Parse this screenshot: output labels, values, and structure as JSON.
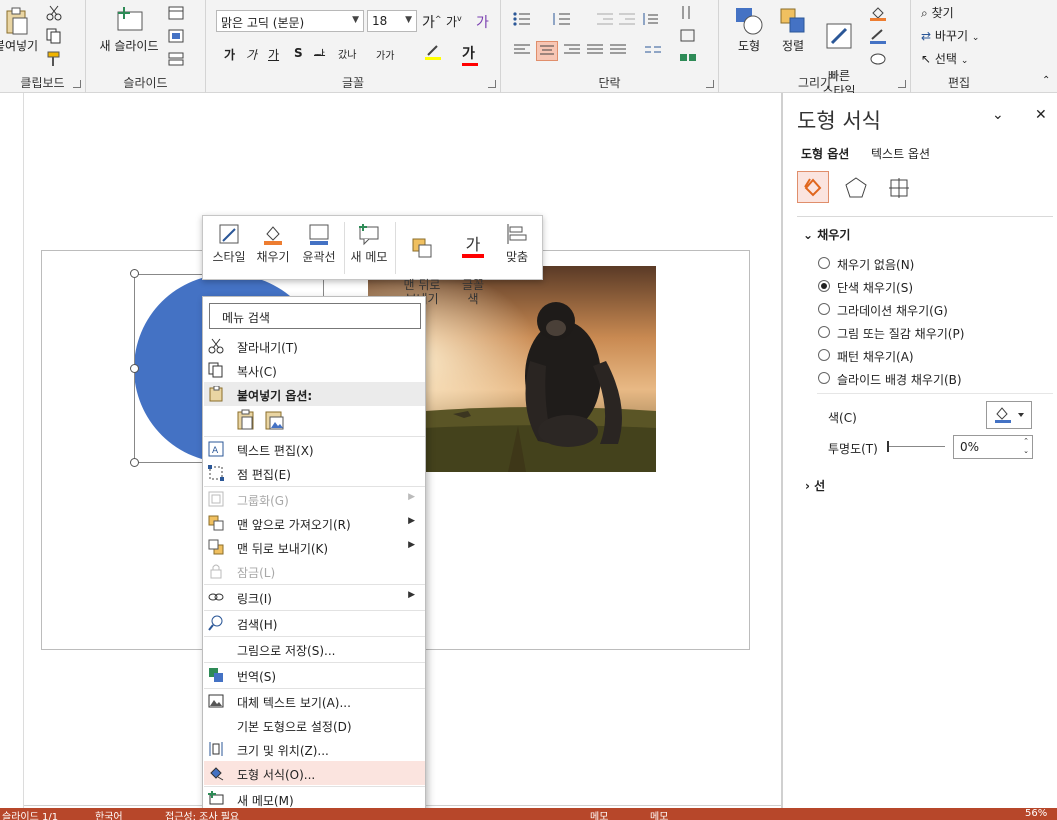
{
  "ribbon": {
    "clipboard": {
      "paste_label": "붙여넣기",
      "group_label": "클립보드"
    },
    "slides": {
      "new_slide_label": "새 슬라이드",
      "group_label": "슬라이드"
    },
    "font": {
      "font_name": "맑은 고딕 (본문)",
      "font_size": "18",
      "grow_label": "가",
      "shrink_label": "가",
      "clear_label": "가",
      "bold": "가",
      "italic": "가",
      "underline": "가",
      "shadow": "S",
      "strike": "ᆉ",
      "spacing": "갔나",
      "case": "가가",
      "highlight_color": "#ffff00",
      "font_color": "#ff0000",
      "font_color_label": "가",
      "group_label": "글꼴"
    },
    "paragraph": {
      "group_label": "단락"
    },
    "drawing": {
      "shapes_label": "도형",
      "arrange_label": "정렬",
      "quick_styles_label": "빠른\n스타일",
      "group_label": "그리기"
    },
    "editing": {
      "find_label": "찾기",
      "replace_label": "바꾸기",
      "select_label": "선택",
      "group_label": "편집"
    }
  },
  "mini_toolbar": {
    "items": [
      {
        "label": "스타일"
      },
      {
        "label": "채우기"
      },
      {
        "label": "윤곽선"
      },
      {
        "label": "새 메모"
      },
      {
        "label": "맨 뒤로\n보내기"
      },
      {
        "label": "글꼴\n색"
      },
      {
        "label": "맞춤"
      }
    ]
  },
  "context_menu": {
    "search_placeholder": "메뉴 검색",
    "items": [
      {
        "label": "잘라내기(T)",
        "icon": "scissors-icon",
        "disabled": false,
        "submenu": false
      },
      {
        "label": "복사(C)",
        "icon": "copy-icon",
        "disabled": false,
        "submenu": false
      },
      {
        "label": "붙여넣기 옵션:",
        "icon": "paste-icon",
        "disabled": false,
        "submenu": false,
        "header": true
      },
      {
        "label": "텍스트 편집(X)",
        "icon": "edit-text-icon",
        "disabled": false,
        "submenu": false
      },
      {
        "label": "점 편집(E)",
        "icon": "edit-points-icon",
        "disabled": false,
        "submenu": false
      },
      {
        "label": "그룹화(G)",
        "icon": "group-icon",
        "disabled": true,
        "submenu": true
      },
      {
        "label": "맨 앞으로 가져오기(R)",
        "icon": "bring-front-icon",
        "disabled": false,
        "submenu": true
      },
      {
        "label": "맨 뒤로 보내기(K)",
        "icon": "send-back-icon",
        "disabled": false,
        "submenu": true
      },
      {
        "label": "잠금(L)",
        "icon": "lock-icon",
        "disabled": true,
        "submenu": false
      },
      {
        "label": "링크(I)",
        "icon": "link-icon",
        "disabled": false,
        "submenu": true
      },
      {
        "label": "검색(H)",
        "icon": "search-icon",
        "disabled": false,
        "submenu": false
      },
      {
        "label": "그림으로 저장(S)...",
        "icon": "",
        "disabled": false,
        "submenu": false
      },
      {
        "label": "번역(S)",
        "icon": "translate-icon",
        "disabled": false,
        "submenu": false
      },
      {
        "label": "대체 텍스트 보기(A)...",
        "icon": "alt-text-icon",
        "disabled": false,
        "submenu": false
      },
      {
        "label": "기본 도형으로 설정(D)",
        "icon": "",
        "disabled": false,
        "submenu": false
      },
      {
        "label": "크기 및 위치(Z)...",
        "icon": "size-position-icon",
        "disabled": false,
        "submenu": false
      },
      {
        "label": "도형 서식(O)...",
        "icon": "format-shape-icon",
        "disabled": false,
        "submenu": false,
        "highlighted": true
      },
      {
        "label": "새 메모(M)",
        "icon": "new-comment-icon",
        "disabled": false,
        "submenu": false
      }
    ]
  },
  "pane": {
    "title": "도형 서식",
    "tab_shape": "도형 옵션",
    "tab_text": "텍스트 옵션",
    "fill_section": "채우기",
    "fill_options": [
      {
        "label": "채우기 없음(N)",
        "selected": false
      },
      {
        "label": "단색 채우기(S)",
        "selected": true
      },
      {
        "label": "그라데이션 채우기(G)",
        "selected": false
      },
      {
        "label": "그림 또는 질감 채우기(P)",
        "selected": false
      },
      {
        "label": "패턴 채우기(A)",
        "selected": false
      },
      {
        "label": "슬라이드 배경 채우기(B)",
        "selected": false
      }
    ],
    "color_label": "색(C)",
    "transparency_label": "투명도(T)",
    "transparency_value": "0%",
    "line_section": "선",
    "fill_color": "#4472c4"
  },
  "shape": {
    "fill_color": "#4472c4"
  },
  "status": {
    "slide": "슬라이드 1/1",
    "language": "한국어",
    "accessibility": "접근성: 조사 필요",
    "notes": "메모",
    "comments": "메모",
    "zoom": "56%"
  }
}
